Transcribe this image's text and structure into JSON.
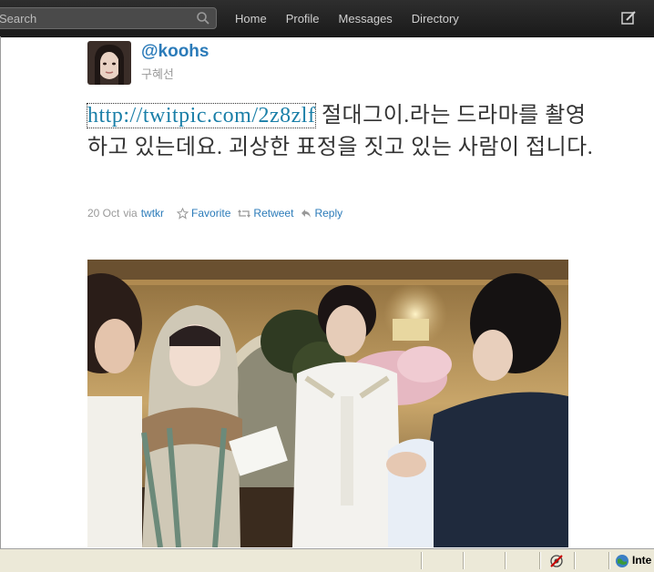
{
  "search": {
    "placeholder": "Search"
  },
  "nav": {
    "home": "Home",
    "profile": "Profile",
    "messages": "Messages",
    "directory": "Directory"
  },
  "profile": {
    "username": "@koohs",
    "realname": "구혜선"
  },
  "tweet": {
    "link": "http://twitpic.com/2z8zlf",
    "text": " 절대그이.라는 드라마를 촬영하고 있는데요. 괴상한 표정을 짓고 있는 사람이 접니다."
  },
  "meta": {
    "date": "20 Oct",
    "via_label": "via",
    "via_source": "twtkr",
    "favorite": "Favorite",
    "retweet": "Retweet",
    "reply": "Reply"
  },
  "statusbar": {
    "zone": "Inte"
  },
  "icons": [
    "search-icon",
    "compose-icon",
    "star-icon",
    "retweet-icon",
    "reply-icon",
    "privacy-icon",
    "globe-icon"
  ],
  "colors": {
    "topbar": "#222222",
    "link": "#2b7bb9",
    "statusbar": "#ece9d8"
  }
}
